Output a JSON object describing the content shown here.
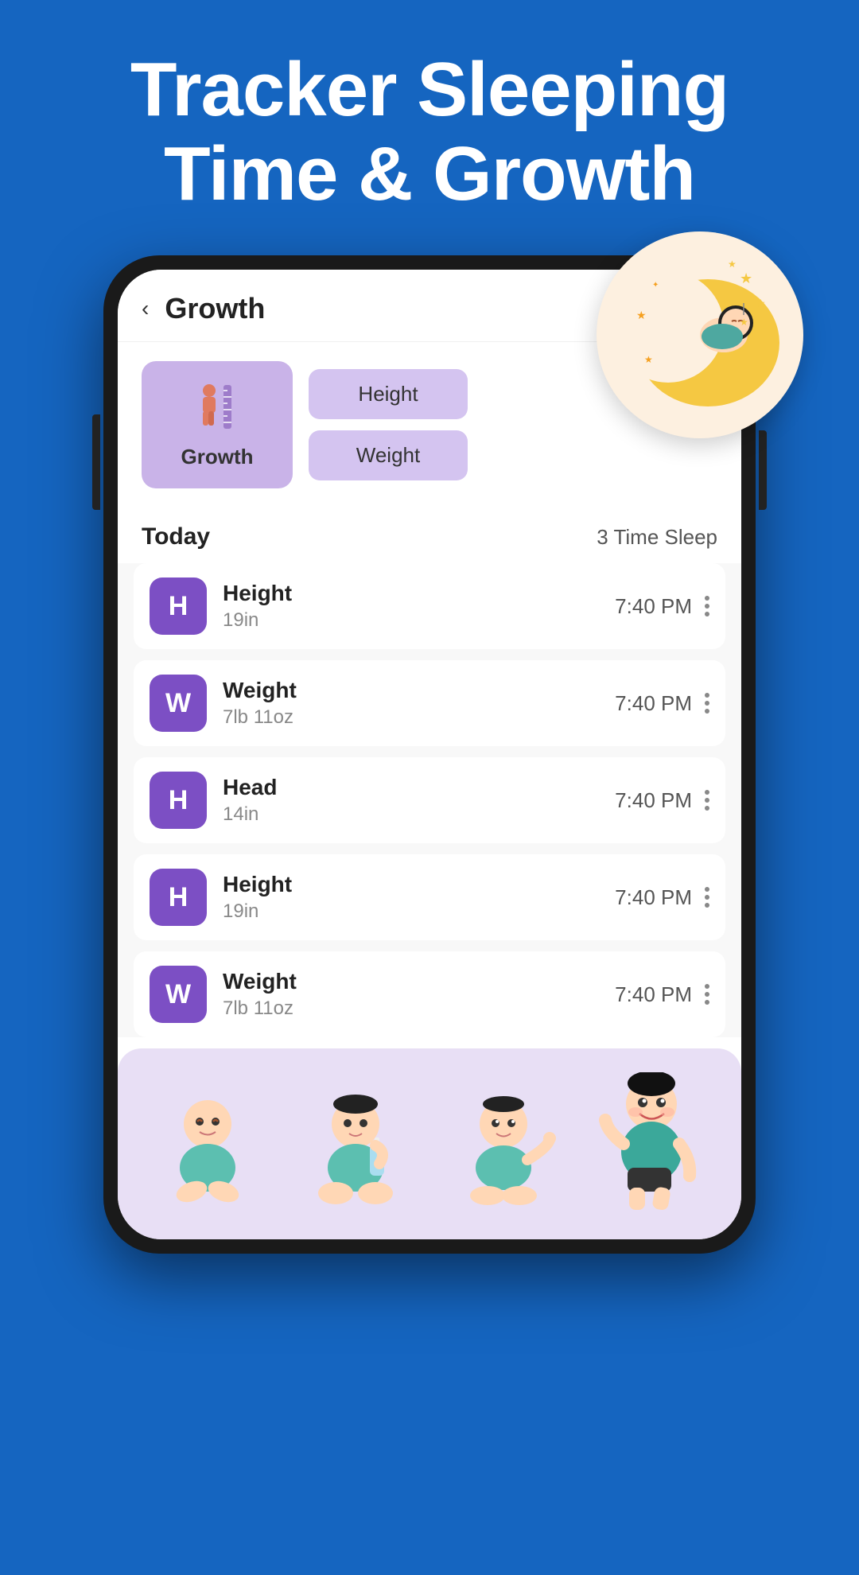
{
  "hero": {
    "title_line1": "Tracker Sleeping",
    "title_line2": "Time & Growth"
  },
  "app": {
    "header": {
      "back_label": "‹",
      "title": "Growth"
    },
    "filter": {
      "growth_card_label": "Growth",
      "growth_icon": "🧍",
      "height_btn": "Height",
      "weight_btn": "Weight"
    },
    "today": {
      "label": "Today",
      "sleep_count": "3 Time Sleep"
    },
    "list_items": [
      {
        "icon": "H",
        "title": "Height",
        "subtitle": "19in",
        "time": "7:40 PM"
      },
      {
        "icon": "W",
        "title": "Weight",
        "subtitle": "7lb 11oz",
        "time": "7:40 PM"
      },
      {
        "icon": "H",
        "title": "Head",
        "subtitle": "14in",
        "time": "7:40 PM"
      },
      {
        "icon": "H",
        "title": "Height",
        "subtitle": "19in",
        "time": "7:40 PM"
      },
      {
        "icon": "W",
        "title": "Weight",
        "subtitle": "7lb 11oz",
        "time": "7:40 PM"
      }
    ]
  },
  "colors": {
    "bg_blue": "#1565C0",
    "purple_card": "#c9b3e8",
    "purple_icon": "#7c4fc4",
    "purple_btn": "#d4c4f0",
    "bottom_banner": "#e8dff5"
  },
  "sleep_icon": "🌙",
  "baby_stages": [
    "👶",
    "🍼",
    "👶",
    "🧒"
  ]
}
